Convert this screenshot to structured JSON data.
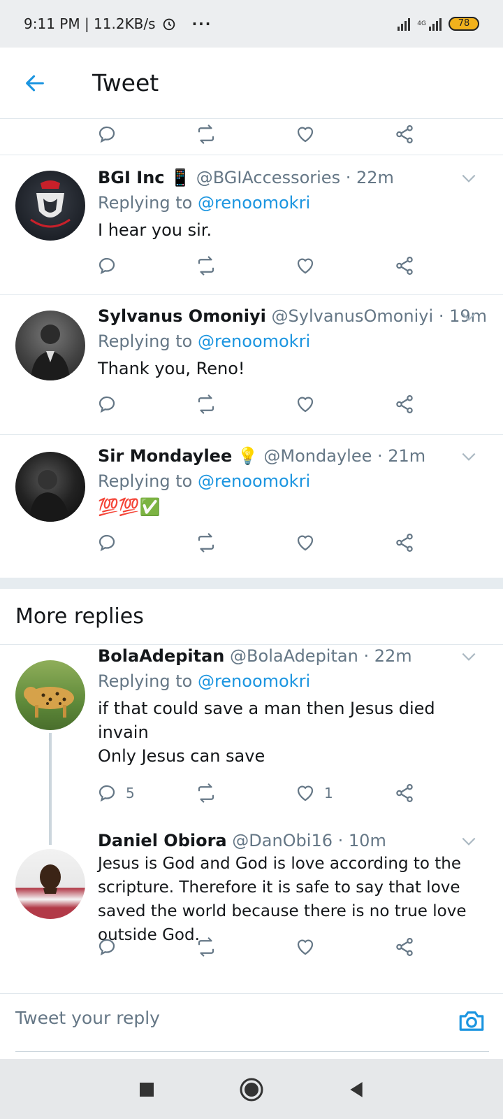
{
  "status_bar": {
    "time_speed": "9:11 PM | 11.2KB/s",
    "dots": "···",
    "network": "4G",
    "battery": "78"
  },
  "header": {
    "title": "Tweet"
  },
  "tweets": [
    {
      "name": "BGI Inc",
      "emoji": "📱",
      "handle": "@BGIAccessories",
      "time": "· 22m",
      "replying_prefix": "Replying to ",
      "mention": "@renoomokri",
      "text": "I hear you sir."
    },
    {
      "name": "Sylvanus Omoniyi",
      "emoji": "",
      "handle": "@SylvanusOmoniyi",
      "time": "· 19m",
      "replying_prefix": "Replying to ",
      "mention": "@renoomokri",
      "text": "Thank you, Reno!"
    },
    {
      "name": "Sir Mondaylee",
      "emoji": "💡",
      "handle": "@Mondaylee",
      "time": "· 21m",
      "replying_prefix": "Replying to ",
      "mention": "@renoomokri",
      "text": "💯💯✅"
    }
  ],
  "more_replies": {
    "label": "More replies"
  },
  "more_tweets": [
    {
      "name": "BolaAdepitan",
      "handle": "@BolaAdepitan",
      "time": "· 22m",
      "replying_prefix": "Replying to ",
      "mention": "@renoomokri",
      "text_line1": "if that could save a man then Jesus died invain",
      "text_line2": "Only Jesus can save",
      "reply_count": "5",
      "like_count": "1"
    },
    {
      "name": "Daniel Obiora",
      "handle": "@DanObi16",
      "time": "· 10m",
      "text": "Jesus is God and God is love according to the scripture. Therefore it is safe to say that love saved the world because there is no true love outside God."
    }
  ],
  "reply_bar": {
    "placeholder": "Tweet your reply"
  },
  "colors": {
    "accent": "#1b95e0",
    "muted": "#657786",
    "border": "#e1e8ed"
  }
}
